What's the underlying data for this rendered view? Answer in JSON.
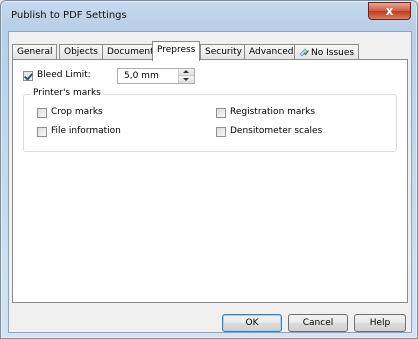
{
  "window": {
    "title": "Publish to PDF Settings",
    "close_label": "x"
  },
  "tabs": [
    {
      "label": "General"
    },
    {
      "label": "Objects"
    },
    {
      "label": "Document"
    },
    {
      "label": "Prepress",
      "active": true
    },
    {
      "label": "Security"
    },
    {
      "label": "Advanced"
    },
    {
      "label": "No Issues",
      "icon": "issues-check-icon"
    }
  ],
  "prepress": {
    "bleed": {
      "checked": true,
      "label": "Bleed Limit:",
      "value": "5,0 mm"
    },
    "printers_marks": {
      "title": "Printer's marks",
      "options": [
        {
          "label": "Crop marks",
          "checked": false
        },
        {
          "label": "Registration marks",
          "checked": false
        },
        {
          "label": "File information",
          "checked": false
        },
        {
          "label": "Densitometer scales",
          "checked": false
        }
      ]
    }
  },
  "buttons": {
    "ok": "OK",
    "cancel": "Cancel",
    "help": "Help"
  },
  "colors": {
    "title_bg": "#c7d9ee",
    "close_red": "#c0391f",
    "default_button_border": "#3c7fb1"
  }
}
